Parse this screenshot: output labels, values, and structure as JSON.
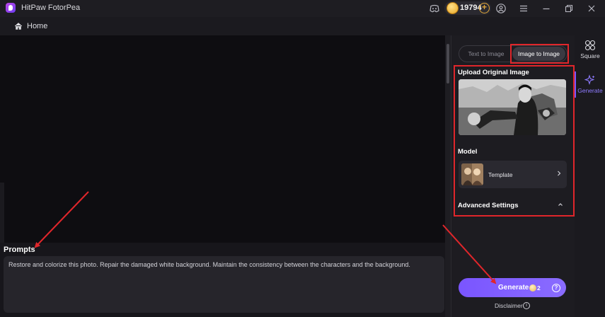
{
  "titlebar": {
    "app_name": "HitPaw FotorPea",
    "coins": "19794"
  },
  "nav": {
    "home_label": "Home"
  },
  "prompt": {
    "label": "Prompts",
    "text": "Restore and colorize this photo. Repair the damaged white background. Maintain the consistency between the characters and the background."
  },
  "panel": {
    "tabs": [
      {
        "label": "Text to Image",
        "active": false
      },
      {
        "label": "Image to Image",
        "active": true
      }
    ],
    "upload_title": "Upload Original Image",
    "model_title": "Model",
    "model_name": "Template",
    "advanced_title": "Advanced Settings",
    "generate_label": "Generate",
    "generate_cost": "2",
    "disclaimer": "Disclaimer"
  },
  "rail": {
    "items": [
      {
        "label": "Square",
        "active": false
      },
      {
        "label": "Generate",
        "active": true
      }
    ]
  },
  "colors": {
    "accent": "#7a55ff",
    "highlight_box": "#e0262b",
    "coin": "#e6a521"
  }
}
